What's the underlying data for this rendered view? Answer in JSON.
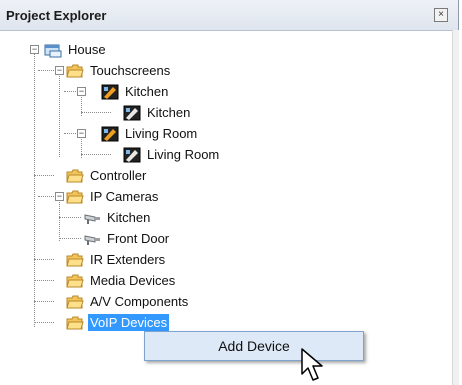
{
  "panel": {
    "title": "Project Explorer",
    "close_glyph": "×"
  },
  "tree": {
    "house": "House",
    "touchscreens": "Touchscreens",
    "kitchen_screen": "Kitchen",
    "kitchen_screen_child": "Kitchen",
    "living_room_screen": "Living Room",
    "living_room_screen_child": "Living Room",
    "controller": "Controller",
    "ip_cameras": "IP Cameras",
    "camera_kitchen": "Kitchen",
    "camera_front_door": "Front Door",
    "ir_extenders": "IR Extenders",
    "media_devices": "Media Devices",
    "av_components": "A/V Components",
    "voip_devices": "VoIP Devices",
    "collapse_glyph": "−"
  },
  "context_menu": {
    "add_device": "Add Device"
  },
  "colors": {
    "selection": "#3399ff",
    "menu_bg": "#dde9f6",
    "folder": "#f2c45a"
  },
  "icons": [
    "house-icon",
    "folder-icon",
    "touchscreen-icon",
    "camera-icon",
    "close-icon",
    "mouse-cursor-icon"
  ]
}
